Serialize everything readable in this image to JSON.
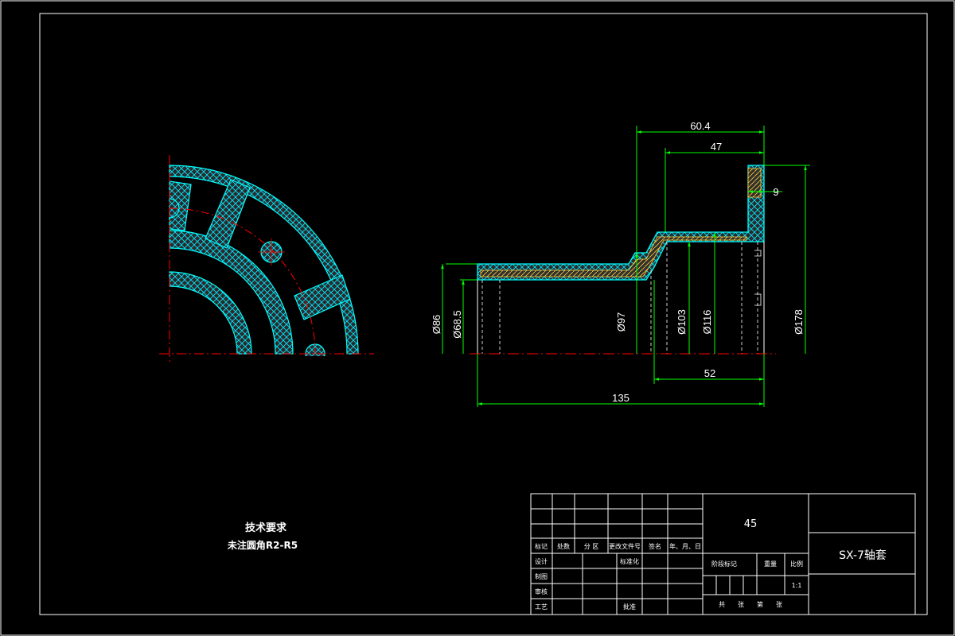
{
  "colors": {
    "background": "#000000",
    "frame": "#ffffff",
    "outline": "#00ffff",
    "center_line": "#ff0000",
    "dimension": "#00ff00",
    "section_fill": "#333333"
  },
  "notes": {
    "title": "技术要求",
    "line1": "未注圆角R2-R5"
  },
  "dimensions": {
    "d_60_4": "60.4",
    "d_47": "47",
    "d_9": "9",
    "d_52": "52",
    "d_135": "135",
    "dia_86": "Ø86",
    "dia_68_5": "Ø68.5",
    "dia_97": "Ø97",
    "dia_103": "Ø103",
    "dia_116": "Ø116",
    "dia_178": "Ø178"
  },
  "title_block": {
    "material": "45",
    "part_name": "SX-7轴套",
    "headers": [
      "标记",
      "处数",
      "分 区",
      "更改文件号",
      "签名",
      "年、月、日"
    ],
    "row_design": "设计",
    "row_standard": "标准化",
    "row_draw": "制图",
    "row_review": "审核",
    "row_process": "工艺",
    "row_approve": "批准",
    "stage_mark": "阶段标记",
    "weight": "重量",
    "scale_label": "比例",
    "scale_value": "1:1",
    "sheet_total": "共",
    "sheet_unit": "张",
    "sheet_no": "第",
    "sheet_unit2": "张"
  }
}
